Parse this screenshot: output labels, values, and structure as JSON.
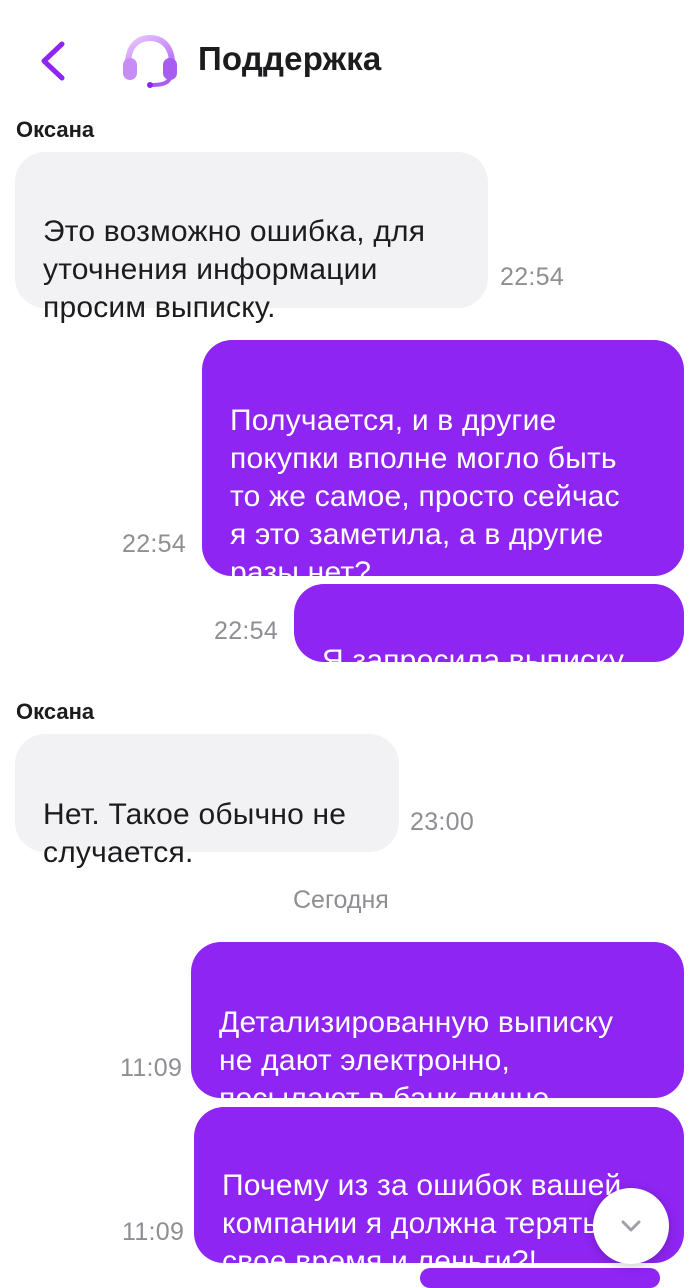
{
  "header": {
    "title": "Поддержка",
    "accent_color": "#8e25f2",
    "back_icon": "chevron-left-icon",
    "avatar_icon": "headset-icon"
  },
  "date_separator": "Сегодня",
  "messages": [
    {
      "direction": "incoming",
      "sender": "Оксана",
      "text": "Это возможно ошибка, для\nуточнения информации\nпросим выписку.",
      "time": "22:54"
    },
    {
      "direction": "outgoing",
      "text": "Получается, и в другие\nпокупки вполне могло быть\nто же самое, просто сейчас\nя это заметила, а в другие\nразы нет?",
      "time": "22:54"
    },
    {
      "direction": "outgoing",
      "text": "Я запросила выписку.",
      "time": "22:54"
    },
    {
      "direction": "incoming",
      "sender": "Оксана",
      "text": "Нет. Такое обычно не\nслучается.",
      "time": "23:00"
    },
    {
      "direction": "outgoing",
      "text": "Детализированную выписку\nне дают электронно,\nпосылают в банк лично",
      "time": "11:09"
    },
    {
      "direction": "outgoing",
      "text": "Почему из за ошибок вашей\nкомпании я должна терять\nсвое время и леньги?!",
      "time": "11:09"
    }
  ],
  "scroll_button_icon": "chevron-down-icon",
  "colors": {
    "incoming_bubble": "#f2f2f5",
    "outgoing_bubble": "#8e25f2",
    "timestamp": "#8e8e93"
  }
}
